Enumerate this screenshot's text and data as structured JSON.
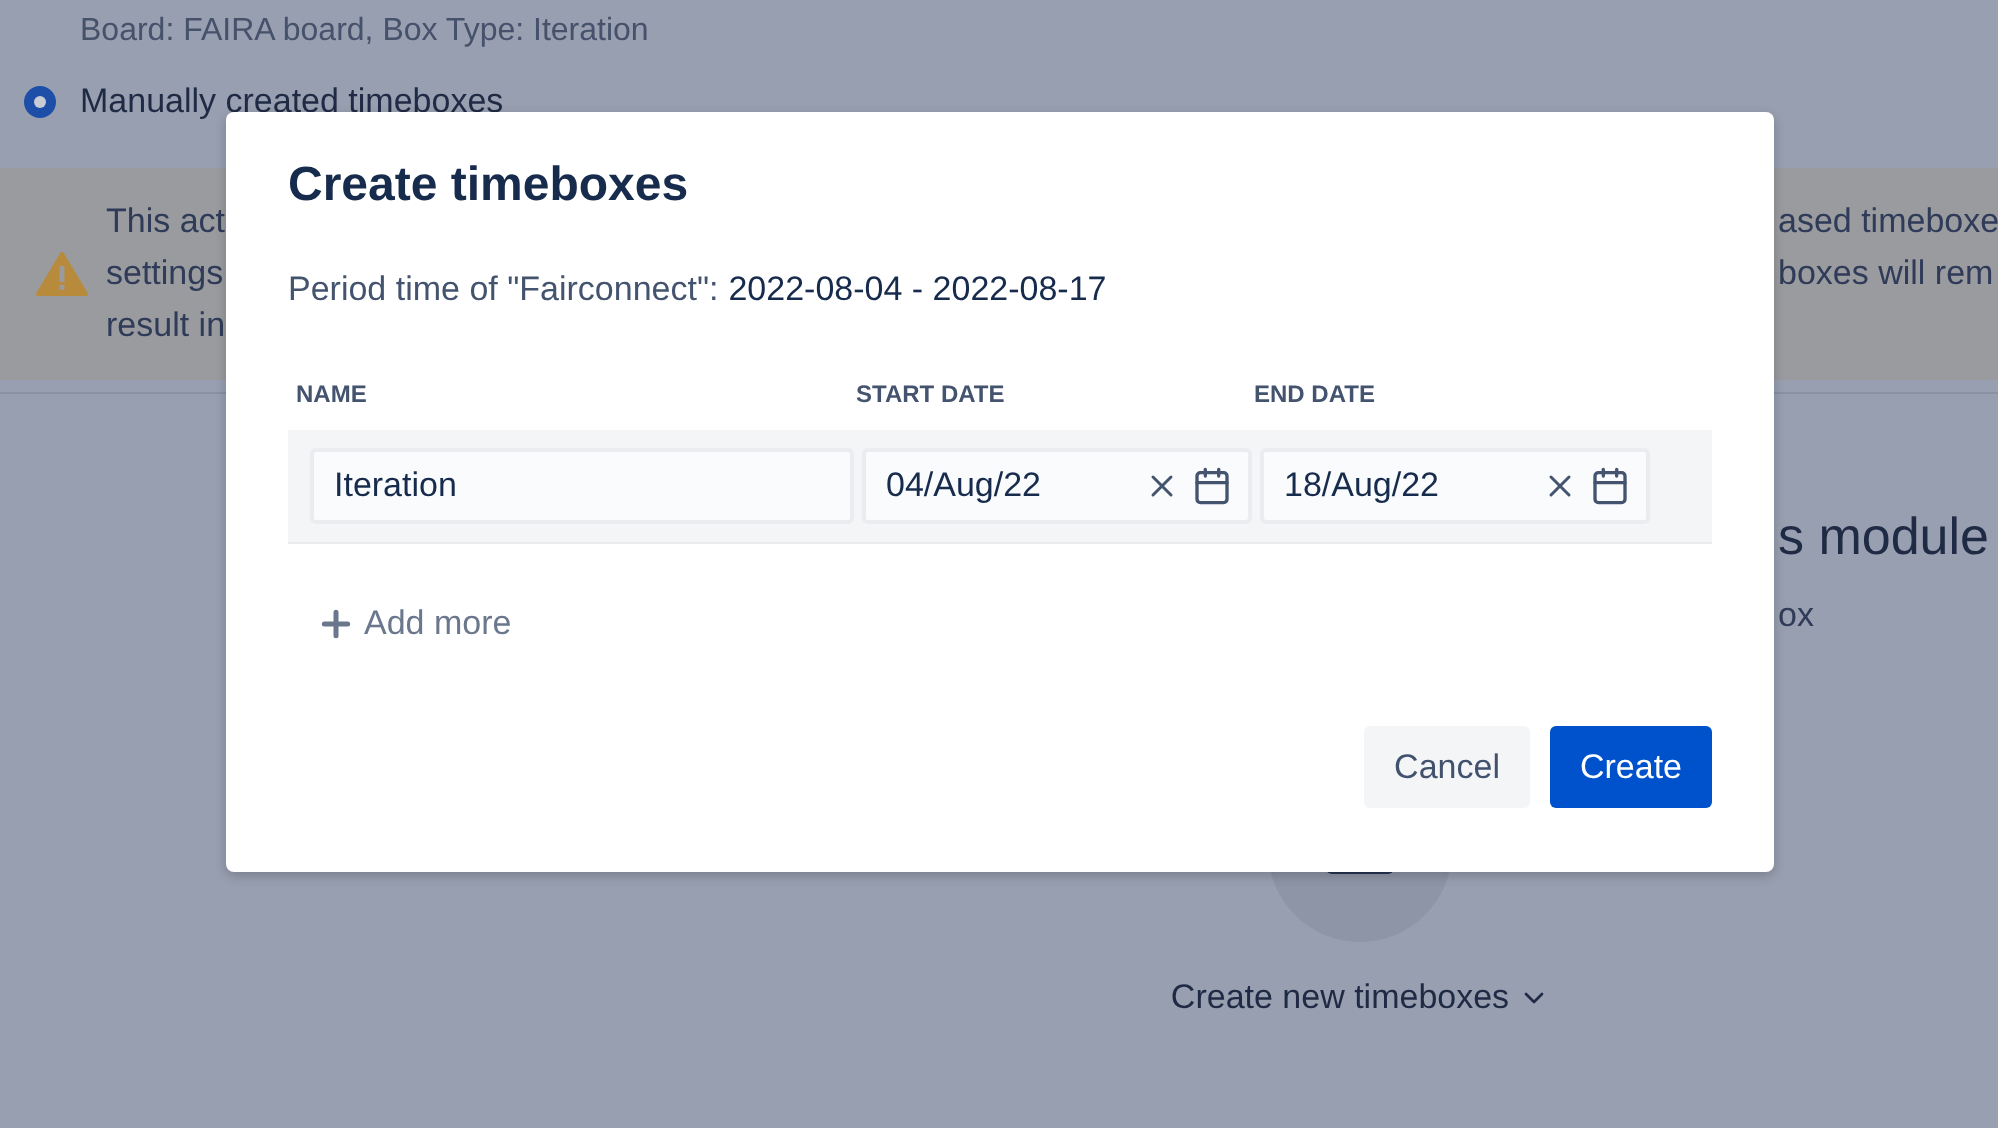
{
  "background": {
    "board_info": "Board: FAIRA board, Box Type: Iteration",
    "radio": {
      "label": "Manually created timeboxes",
      "selected": true
    },
    "warning": {
      "left_lines": [
        "This act",
        "settings",
        "result in"
      ],
      "right_lines": [
        "ased timeboxe",
        "boxes will rem"
      ]
    },
    "module_title": "s module",
    "module_text": "ox",
    "create_menu": "Create new timeboxes"
  },
  "dialog": {
    "title": "Create timeboxes",
    "period_label": "Period time of \"Fairconnect\":",
    "period_value": "2022-08-04 - 2022-08-17",
    "columns": [
      "NAME",
      "START DATE",
      "END DATE"
    ],
    "rows": [
      {
        "name": "Iteration",
        "start_date": "04/Aug/22",
        "end_date": "18/Aug/22"
      }
    ],
    "add_more": "Add more",
    "buttons": [
      {
        "label": "Cancel",
        "kind": "secondary"
      },
      {
        "label": "Create",
        "kind": "primary"
      }
    ]
  }
}
